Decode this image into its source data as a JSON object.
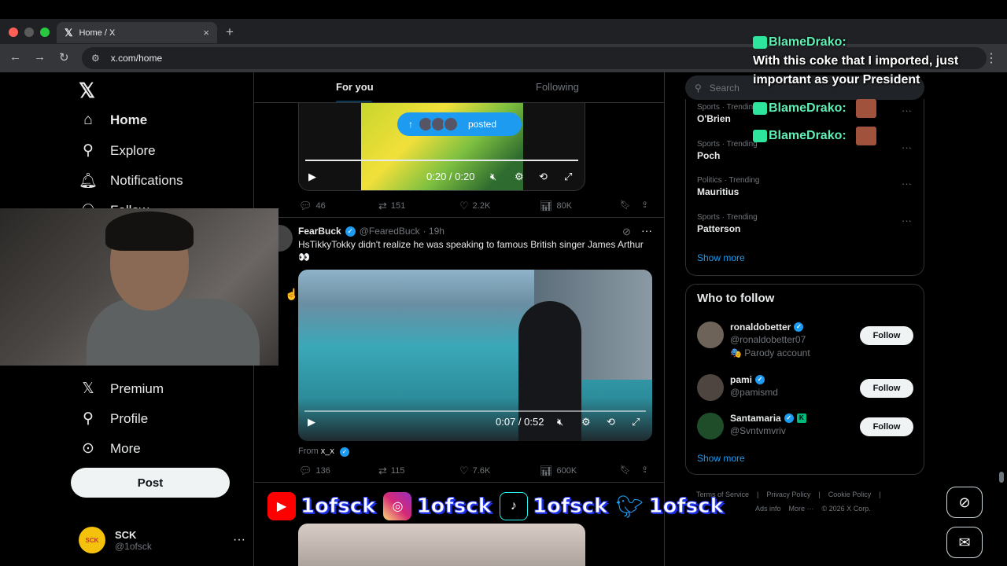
{
  "browser": {
    "tab_title": "Home / X",
    "tab_icon": "x-logo-icon",
    "address": "x.com/home"
  },
  "nav": {
    "logo": "𝕏",
    "items": [
      {
        "label": "Home",
        "icon": "home-icon",
        "active": true
      },
      {
        "label": "Explore",
        "icon": "search-icon"
      },
      {
        "label": "Notifications",
        "icon": "bell-icon"
      },
      {
        "label": "Follow",
        "icon": "people-icon"
      },
      {
        "label": "Premium",
        "icon": "x-logo-icon"
      },
      {
        "label": "Profile",
        "icon": "person-icon"
      },
      {
        "label": "More",
        "icon": "more-circle-icon"
      }
    ],
    "post_label": "Post",
    "account": {
      "name": "SCK",
      "handle": "@1ofsck",
      "avatar_text": "SCK"
    }
  },
  "feed": {
    "tabs": [
      "For you",
      "Following"
    ],
    "posted_pill": "posted",
    "tweet1": {
      "video_time": "0:20 / 0:20",
      "progress": 1.0,
      "stats": {
        "replies": "46",
        "reposts": "151",
        "likes": "2.2K",
        "views": "80K"
      }
    },
    "tweet2": {
      "name": "FearBuck",
      "handle": "@FearedBuck",
      "time": "· 19h",
      "text": "HsTikkyTokky didn't realize he was speaking to famous British singer James Arthur 👀",
      "video_time": "0:07 / 0:52",
      "progress": 0.13,
      "from_label": "From",
      "from_user": "x_x",
      "stats": {
        "replies": "136",
        "reposts": "115",
        "likes": "7.6K",
        "views": "600K"
      }
    }
  },
  "sidebar": {
    "search_placeholder": "Search",
    "trends": [
      {
        "category": "Sports · Trending",
        "title": "O'Brien"
      },
      {
        "category": "Sports · Trending",
        "title": "Poch"
      },
      {
        "category": "Politics · Trending",
        "title": "Mauritius"
      },
      {
        "category": "Sports · Trending",
        "title": "Patterson"
      }
    ],
    "show_more": "Show more",
    "who_to_follow_title": "Who to follow",
    "who_to_follow": [
      {
        "name": "ronaldobetter",
        "handle": "@ronaldobetter07",
        "note": "🎭 Parody account",
        "button": "Follow"
      },
      {
        "name": "pami",
        "handle": "@pamismd",
        "button": "Follow"
      },
      {
        "name": "Santamaria",
        "handle": "@Svntvmvriv",
        "button": "Follow"
      }
    ],
    "show_more_2": "Show more",
    "footer": [
      "Terms of Service",
      "|",
      "Privacy Policy",
      "|",
      "Cookie Policy",
      "|",
      "Ads info",
      "More ···",
      "© 2026 X Corp."
    ]
  },
  "overlay": {
    "chat": [
      {
        "user": "BlameDrako",
        "sep": ":",
        "message": "With this coke that I imported, just important as your President"
      },
      {
        "user": "BlameDrako",
        "sep": ":"
      },
      {
        "user": "BlameDrako",
        "sep": ":"
      }
    ],
    "socials": [
      "1ofsck",
      "1ofsck",
      "1ofsck",
      "1ofsck"
    ]
  }
}
